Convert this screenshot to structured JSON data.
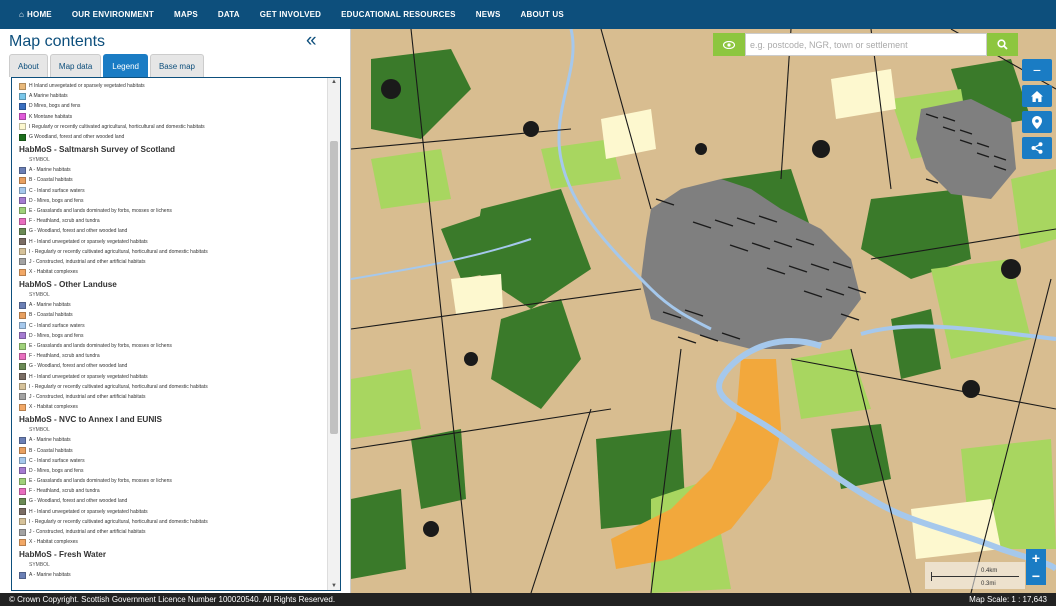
{
  "nav": {
    "items": [
      {
        "label": "HOME"
      },
      {
        "label": "OUR ENVIRONMENT"
      },
      {
        "label": "MAPS"
      },
      {
        "label": "DATA"
      },
      {
        "label": "GET INVOLVED"
      },
      {
        "label": "EDUCATIONAL RESOURCES"
      },
      {
        "label": "NEWS"
      },
      {
        "label": "ABOUT US"
      }
    ]
  },
  "sidebar": {
    "title": "Map contents",
    "collapse_glyph": "«",
    "tabs": [
      {
        "label": "About",
        "active": false
      },
      {
        "label": "Map data",
        "active": false
      },
      {
        "label": "Legend",
        "active": true
      },
      {
        "label": "Base map",
        "active": false
      }
    ]
  },
  "legend": {
    "top_items": [
      {
        "label": "H Inland unvegetated or sparsely vegetated habitats",
        "color": "#e8b87a"
      },
      {
        "label": "A Marine habitats",
        "color": "#7ac7ea"
      },
      {
        "label": "D Mires, bogs and fens",
        "color": "#3a6fc0"
      },
      {
        "label": "K Montane habitats",
        "color": "#e05ad8"
      },
      {
        "label": "I Regularly or recently cultivated agricultural, horticultural and domestic habitats",
        "color": "#fdf8cf"
      },
      {
        "label": "G Woodland, forest and other wooded land",
        "color": "#1c6e1c"
      }
    ],
    "symbol_label": "SYMBOL",
    "sections": [
      {
        "heading": "HabMoS - Saltmarsh Survey of Scotland",
        "items": [
          {
            "label": "A - Marine habitats",
            "color": "#6a7fb5"
          },
          {
            "label": "B - Coastal habitats",
            "color": "#e8a060"
          },
          {
            "label": "C - Inland surface waters",
            "color": "#a5c8ec"
          },
          {
            "label": "D - Mires, bogs and fens",
            "color": "#a57bd1"
          },
          {
            "label": "E - Grasslands and lands dominated by forbs, mosses or lichens",
            "color": "#9fd17a"
          },
          {
            "label": "F - Heathland, scrub and tundra",
            "color": "#e86fbf"
          },
          {
            "label": "G - Woodland, forest and other wooded land",
            "color": "#6b8a55"
          },
          {
            "label": "H - Inland unvegetated or sparsely vegetated habitats",
            "color": "#7a6d64"
          },
          {
            "label": "I - Regularly or recently cultivated agricultural, horticultural and domestic habitats",
            "color": "#d6c29a"
          },
          {
            "label": "J - Constructed, industrial and other artificial habitats",
            "color": "#a3a3a3"
          },
          {
            "label": "X - Habitat complexes",
            "color": "#f2a866"
          }
        ]
      },
      {
        "heading": "HabMoS - Other Landuse",
        "items": [
          {
            "label": "A - Marine habitats",
            "color": "#6a7fb5"
          },
          {
            "label": "B - Coastal habitats",
            "color": "#e8a060"
          },
          {
            "label": "C - Inland surface waters",
            "color": "#a5c8ec"
          },
          {
            "label": "D - Mires, bogs and fens",
            "color": "#a57bd1"
          },
          {
            "label": "E - Grasslands and lands dominated by forbs, mosses or lichens",
            "color": "#9fd17a"
          },
          {
            "label": "F - Heathland, scrub and tundra",
            "color": "#e86fbf"
          },
          {
            "label": "G - Woodland, forest and other wooded land",
            "color": "#6b8a55"
          },
          {
            "label": "H - Inland unvegetated or sparsely vegetated habitats",
            "color": "#7a6d64"
          },
          {
            "label": "I - Regularly or recently cultivated agricultural, horticultural and domestic habitats",
            "color": "#d6c29a"
          },
          {
            "label": "J - Constructed, industrial and other artificial habitats",
            "color": "#a3a3a3"
          },
          {
            "label": "X - Habitat complexes",
            "color": "#f2a866"
          }
        ]
      },
      {
        "heading": "HabMoS - NVC to Annex I and EUNIS",
        "items": [
          {
            "label": "A - Marine habitats",
            "color": "#6a7fb5"
          },
          {
            "label": "B - Coastal habitats",
            "color": "#e8a060"
          },
          {
            "label": "C - Inland surface waters",
            "color": "#a5c8ec"
          },
          {
            "label": "D - Mires, bogs and fens",
            "color": "#a57bd1"
          },
          {
            "label": "E - Grasslands and lands dominated by forbs, mosses or lichens",
            "color": "#9fd17a"
          },
          {
            "label": "F - Heathland, scrub and tundra",
            "color": "#e86fbf"
          },
          {
            "label": "G - Woodland, forest and other wooded land",
            "color": "#6b8a55"
          },
          {
            "label": "H - Inland unvegetated or sparsely vegetated habitats",
            "color": "#7a6d64"
          },
          {
            "label": "I - Regularly or recently cultivated agricultural, horticultural and domestic habitats",
            "color": "#d6c29a"
          },
          {
            "label": "J - Constructed, industrial and other artificial habitats",
            "color": "#a3a3a3"
          },
          {
            "label": "X - Habitat complexes",
            "color": "#f2a866"
          }
        ]
      },
      {
        "heading": "HabMoS - Fresh Water",
        "items": [
          {
            "label": "A - Marine habitats",
            "color": "#6a7fb5"
          }
        ]
      }
    ]
  },
  "map": {
    "search_placeholder": "e.g. postcode, NGR, town or settlement",
    "colors": {
      "farmland": "#d8bd90",
      "woodland": "#3a7a2a",
      "grassland": "#a8d660",
      "cultivated": "#fdf8cf",
      "urban": "#7f7f7f",
      "river": "#a5c8ec",
      "coastal": "#f2a83c",
      "dark": "#1a1a1a",
      "accent_green": "#8dc63f",
      "control_blue": "#1a7cc4"
    },
    "scale_km": "0.4km",
    "scale_mi": "0.3mi"
  },
  "footer": {
    "copyright": "© Crown Copyright. Scottish Government Licence Number 100020540. All Rights Reserved.",
    "scale": "Map Scale: 1 : 17,643"
  }
}
